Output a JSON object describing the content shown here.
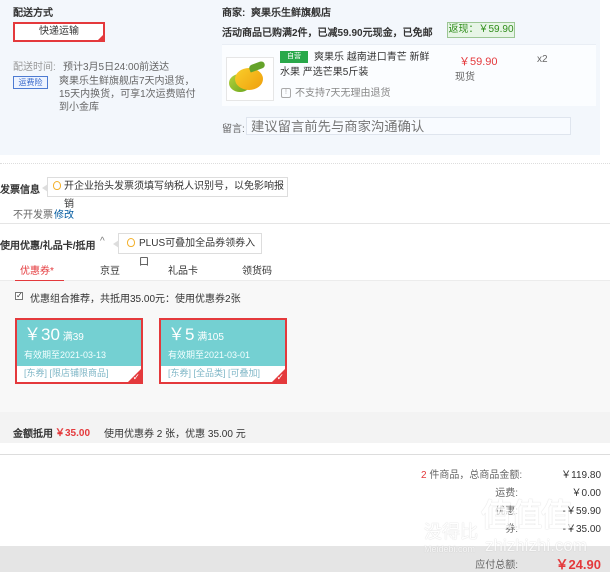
{
  "shipping": {
    "title": "配送方式",
    "method": "快递运输",
    "time_label": "配送时间:",
    "time_value": "预计3月5日24:00前送达",
    "badge": "运费险",
    "freight_note": "爽果乐生鲜旗舰店7天内退货，15天内换货，可享1次运费赔付到小金库"
  },
  "seller": {
    "label": "商家:",
    "name": "爽果乐生鲜旗舰店"
  },
  "promotion": {
    "text": "活动商品已购满2件，已减59.90元现金，已免邮",
    "rebate": "返现：￥59.90"
  },
  "product": {
    "tag": "自营",
    "title": "爽果乐 越南进口青芒 新鲜水果 严选芒果5斤装",
    "price": "￥59.90",
    "stock": "现货",
    "quantity": "x2",
    "return_icon": "!",
    "return_text": "不支持7天无理由退货"
  },
  "message": {
    "label": "留言:",
    "placeholder": "建议留言前先与商家沟通确认"
  },
  "invoice": {
    "label": "发票信息",
    "tip": "开企业抬头发票须填写纳税人识别号，以免影响报销",
    "status": "不开发票",
    "edit": "修改"
  },
  "coupons": {
    "label": "使用优惠/礼品卡/抵用",
    "chevron": "^",
    "plus_tip": "PLUS可叠加全品券领券入口",
    "tabs": [
      "优惠券*",
      "京豆",
      "礼品卡",
      "领货码"
    ],
    "recommendation": "优惠组合推荐，共抵用35.00元：使用优惠券2张",
    "check": "✓",
    "items": [
      {
        "value": "￥30",
        "condition": "满39",
        "expiry": "有效期至2021-03-13",
        "tags": "[东券] [限店铺限商品]"
      },
      {
        "value": "￥5",
        "condition": "满105",
        "expiry": "有效期至2021-03-01",
        "tags": "[东券] [全品类] [可叠加]"
      }
    ]
  },
  "deduction": {
    "label": "金额抵用",
    "value": "￥35.00",
    "note": "使用优惠券 2 张，优惠 35.00 元"
  },
  "summary": {
    "count_prefix": "2",
    "count_text": "件商品，总商品金额:",
    "goods_amount": "￥119.80",
    "freight_label": "运费:",
    "freight": "￥0.00",
    "discount_label": "优惠:",
    "discount": "-￥59.90",
    "coupon_label": "券:",
    "coupon": "-￥35.00",
    "payable_label": "应付总额:",
    "payable": "￥24.90"
  },
  "watermark": {
    "brand": "值值值",
    "left_text": "没得比",
    "domain": "zhizhizhi.com",
    "small": "Meidebi.com"
  },
  "colors": {
    "accent": "#e4393c",
    "coupon": "#74d0d2",
    "link": "#005aa0"
  },
  "icons": {
    "tip": "lightbulb-icon",
    "check": "checkmark-icon",
    "return": "info-icon"
  }
}
